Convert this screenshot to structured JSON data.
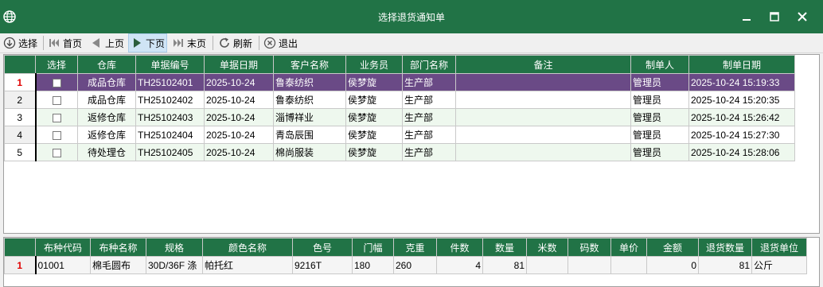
{
  "window": {
    "title": "选择退货通知单"
  },
  "toolbar": {
    "select": "选择",
    "first": "首页",
    "prev": "上页",
    "next": "下页",
    "last": "末页",
    "refresh": "刷新",
    "exit": "退出"
  },
  "notices": {
    "columns": [
      "选择",
      "仓库",
      "单据编号",
      "单据日期",
      "客户名称",
      "业务员",
      "部门名称",
      "备注",
      "制单人",
      "制单日期"
    ],
    "rows": [
      {
        "no": "1",
        "warehouse": "成品仓库",
        "doc_no": "TH25102401",
        "date": "2025-10-24",
        "customer": "鲁泰纺织",
        "salesman": "侯梦旋",
        "dept": "生产部",
        "note": "",
        "maker": "管理员",
        "made_at": "2025-10-24 15:19:33"
      },
      {
        "no": "2",
        "warehouse": "成品仓库",
        "doc_no": "TH25102402",
        "date": "2025-10-24",
        "customer": "鲁泰纺织",
        "salesman": "侯梦旋",
        "dept": "生产部",
        "note": "",
        "maker": "管理员",
        "made_at": "2025-10-24 15:20:35"
      },
      {
        "no": "3",
        "warehouse": "返修仓库",
        "doc_no": "TH25102403",
        "date": "2025-10-24",
        "customer": "淄博祥业",
        "salesman": "侯梦旋",
        "dept": "生产部",
        "note": "",
        "maker": "管理员",
        "made_at": "2025-10-24 15:26:42"
      },
      {
        "no": "4",
        "warehouse": "返修仓库",
        "doc_no": "TH25102404",
        "date": "2025-10-24",
        "customer": "青岛辰围",
        "salesman": "侯梦旋",
        "dept": "生产部",
        "note": "",
        "maker": "管理员",
        "made_at": "2025-10-24 15:27:30"
      },
      {
        "no": "5",
        "warehouse": "待处理仓",
        "doc_no": "TH25102405",
        "date": "2025-10-24",
        "customer": "棉尚服装",
        "salesman": "侯梦旋",
        "dept": "生产部",
        "note": "",
        "maker": "管理员",
        "made_at": "2025-10-24 15:28:06"
      }
    ]
  },
  "details": {
    "columns": [
      "布种代码",
      "布种名称",
      "规格",
      "颜色名称",
      "色号",
      "门幅",
      "克重",
      "件数",
      "数量",
      "米数",
      "码数",
      "单价",
      "金额",
      "退货数量",
      "退货单位"
    ],
    "rows": [
      {
        "no": "1",
        "code": "01001",
        "name": "棉毛圆布",
        "spec": "30D/36F 涤",
        "color": "帕托红",
        "color_no": "9216T",
        "width": "180",
        "weight": "260",
        "pieces": "4",
        "qty": "81",
        "meters": "",
        "yards": "",
        "price": "",
        "amount": "0",
        "return_qty": "81",
        "return_unit": "公斤"
      }
    ]
  },
  "colors": {
    "header": "#217346",
    "selected_row": "#6a4a86",
    "current_row_marker": "#e00000"
  }
}
